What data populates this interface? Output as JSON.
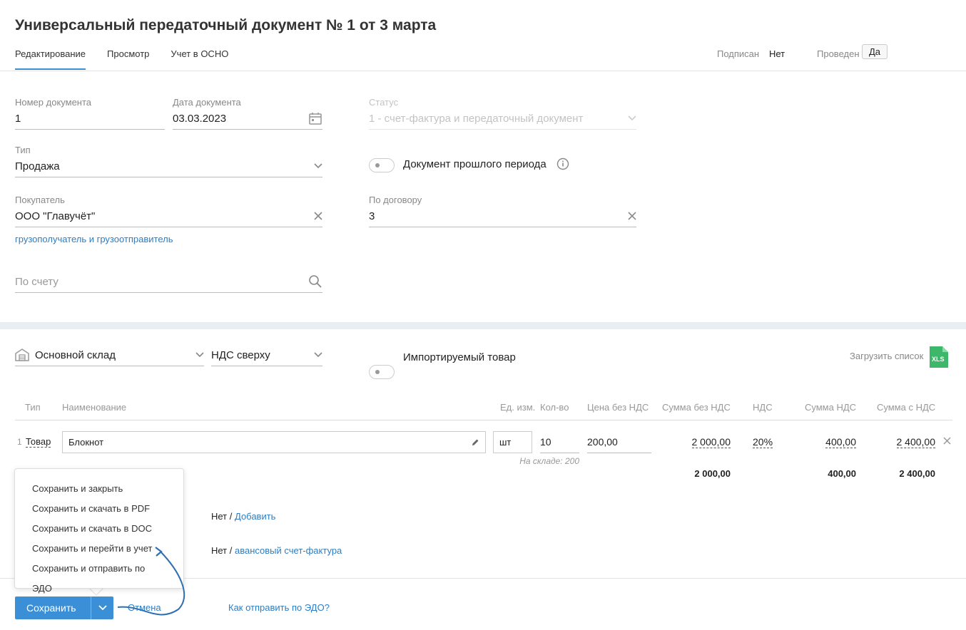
{
  "page": {
    "title": "Универсальный передаточный документ № 1 от 3 марта"
  },
  "tabs": [
    {
      "label": "Редактирование"
    },
    {
      "label": "Просмотр"
    },
    {
      "label": "Учет в ОСНО"
    }
  ],
  "status": {
    "signed_label": "Подписан",
    "signed_value": "Нет",
    "posted_label": "Проведен",
    "posted_value": "Да"
  },
  "form": {
    "doc_number": {
      "label": "Номер документа",
      "value": "1"
    },
    "doc_date": {
      "label": "Дата документа",
      "value": "03.03.2023"
    },
    "doc_status": {
      "label": "Статус",
      "value": "1 - счет-фактура и передаточный документ"
    },
    "type": {
      "label": "Тип",
      "value": "Продажа"
    },
    "past_period": {
      "label": "Документ прошлого периода"
    },
    "buyer": {
      "label": "Покупатель",
      "value": "ООО \"Главучёт\""
    },
    "contract": {
      "label": "По договору",
      "value": "3"
    },
    "consignee_link": "грузополучатель и грузоотправитель",
    "invoice": {
      "placeholder": "По счету"
    }
  },
  "goods": {
    "warehouse": "Основной склад",
    "vat_mode": "НДС сверху",
    "imported_label": "Импортируемый товар",
    "upload_label": "Загрузить список",
    "upload_icon_text": "XLS",
    "columns": [
      "Тип",
      "Наименование",
      "Ед. изм.",
      "Кол-во",
      "Цена без НДС",
      "Сумма без НДС",
      "НДС",
      "Сумма НДС",
      "Сумма с НДС"
    ],
    "rows": [
      {
        "num": "1",
        "type": "Товар",
        "name": "Блокнот",
        "unit": "шт",
        "qty": "10",
        "price": "200,00",
        "sum_no_vat": "2 000,00",
        "vat": "20%",
        "vat_sum": "400,00",
        "total": "2 400,00",
        "stock": "На складе: 200"
      }
    ],
    "totals": {
      "sum_no_vat": "2 000,00",
      "vat_sum": "400,00",
      "total": "2 400,00"
    }
  },
  "extras": [
    {
      "value": "Нет /",
      "link": "Добавить"
    },
    {
      "value": "Нет /",
      "link": "авансовый счет-фактура"
    }
  ],
  "save_menu": [
    "Сохранить и закрыть",
    "Сохранить и скачать в PDF",
    "Сохранить и скачать в DOC",
    "Сохранить и перейти в учет",
    "Сохранить и отправить по ЭДО"
  ],
  "footer": {
    "save_label": "Сохранить",
    "cancel_label": "Отмена",
    "edo_help": "Как отправить по ЭДО?"
  },
  "colors": {
    "accent": "#3a8fd6",
    "link": "#2e7dc2",
    "xls": "#3db86b"
  }
}
